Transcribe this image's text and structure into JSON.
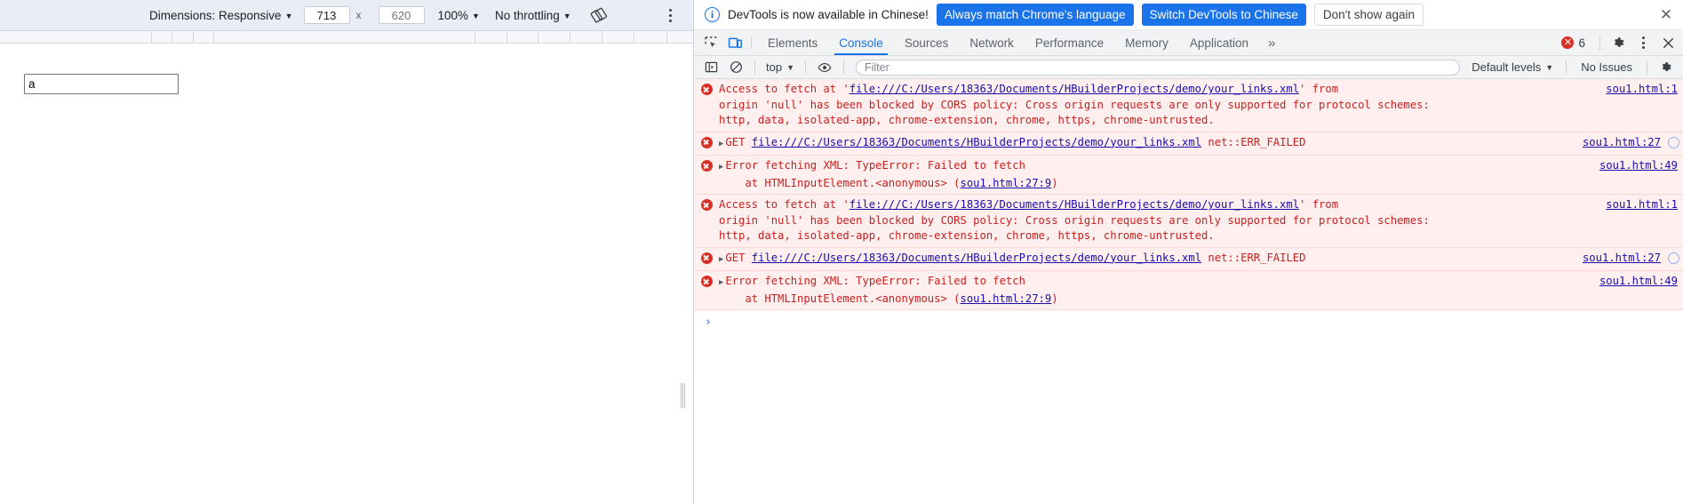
{
  "device_toolbar": {
    "dimensions_label": "Dimensions: Responsive",
    "width_value": "713",
    "height_placeholder": "620",
    "zoom_label": "100%",
    "throttling_label": "No throttling",
    "rotate_icon": "rotate-device-icon",
    "menu_icon": "more-options-icon"
  },
  "page": {
    "input_value": "a",
    "input_placeholder": ""
  },
  "notice": {
    "icon": "info-icon",
    "text": "DevTools is now available in Chinese!",
    "primary_button": "Always match Chrome's language",
    "secondary_button": "Switch DevTools to Chinese",
    "dismiss_button": "Don't show again",
    "close_icon": "close-icon"
  },
  "tabbar": {
    "inspect_icon": "inspect-element-icon",
    "device_icon": "toggle-device-toolbar-icon",
    "tabs": [
      {
        "label": "Elements",
        "active": false
      },
      {
        "label": "Console",
        "active": true
      },
      {
        "label": "Sources",
        "active": false
      },
      {
        "label": "Network",
        "active": false
      },
      {
        "label": "Performance",
        "active": false
      },
      {
        "label": "Memory",
        "active": false
      },
      {
        "label": "Application",
        "active": false
      }
    ],
    "overflow_label": "»",
    "error_count": "6",
    "settings_icon": "gear-icon",
    "menu_icon": "more-options-icon",
    "close_icon": "close-devtools-icon"
  },
  "console_toolbar": {
    "sidebar_icon": "console-sidebar-icon",
    "clear_icon": "clear-console-icon",
    "context_label": "top",
    "eye_icon": "live-expression-icon",
    "filter_placeholder": "Filter",
    "filter_value": "",
    "levels_label": "Default levels",
    "issues_label": "No Issues",
    "settings_icon": "gear-icon"
  },
  "console_messages": [
    {
      "icon": "error-icon",
      "expandable": false,
      "parts": [
        {
          "t": "Access to fetch at '",
          "link": false
        },
        {
          "t": "file:///C:/Users/18363/Documents/HBuilderProjects/demo/your_links.xml",
          "link": true
        },
        {
          "t": "' from\norigin 'null' has been blocked by CORS policy: Cross origin requests are only supported for protocol schemes:\nhttp, data, isolated-app, chrome-extension, chrome, https, chrome-untrusted.",
          "link": false
        }
      ],
      "source": "sou1.html:1",
      "has_globe": false
    },
    {
      "icon": "error-icon",
      "expandable": true,
      "parts": [
        {
          "t": "GET ",
          "link": false
        },
        {
          "t": "file:///C:/Users/18363/Documents/HBuilderProjects/demo/your_links.xml",
          "link": true
        },
        {
          "t": " net::ERR_FAILED",
          "link": false
        }
      ],
      "source": "sou1.html:27",
      "has_globe": true
    },
    {
      "icon": "error-icon",
      "expandable": true,
      "parts": [
        {
          "t": "Error fetching XML: TypeError: Failed to fetch\n    at HTMLInputElement.<anonymous> (",
          "link": false
        },
        {
          "t": "sou1.html:27:9",
          "link": true
        },
        {
          "t": ")",
          "link": false
        }
      ],
      "source": "sou1.html:49",
      "has_globe": false
    },
    {
      "icon": "error-icon",
      "expandable": false,
      "parts": [
        {
          "t": "Access to fetch at '",
          "link": false
        },
        {
          "t": "file:///C:/Users/18363/Documents/HBuilderProjects/demo/your_links.xml",
          "link": true
        },
        {
          "t": "' from\norigin 'null' has been blocked by CORS policy: Cross origin requests are only supported for protocol schemes:\nhttp, data, isolated-app, chrome-extension, chrome, https, chrome-untrusted.",
          "link": false
        }
      ],
      "source": "sou1.html:1",
      "has_globe": false
    },
    {
      "icon": "error-icon",
      "expandable": true,
      "parts": [
        {
          "t": "GET ",
          "link": false
        },
        {
          "t": "file:///C:/Users/18363/Documents/HBuilderProjects/demo/your_links.xml",
          "link": true
        },
        {
          "t": " net::ERR_FAILED",
          "link": false
        }
      ],
      "source": "sou1.html:27",
      "has_globe": true
    },
    {
      "icon": "error-icon",
      "expandable": true,
      "parts": [
        {
          "t": "Error fetching XML: TypeError: Failed to fetch\n    at HTMLInputElement.<anonymous> (",
          "link": false
        },
        {
          "t": "sou1.html:27:9",
          "link": true
        },
        {
          "t": ")",
          "link": false
        }
      ],
      "source": "sou1.html:49",
      "has_globe": false
    }
  ],
  "console_prompt": {
    "symbol": "›"
  },
  "colors": {
    "accent": "#1a73e8",
    "error": "#d93025",
    "error_bg": "#fff0ef",
    "link": "#1a0dab",
    "toolbar_bg": "#f1f3f4",
    "device_toolbar_bg": "#e9edf6"
  }
}
